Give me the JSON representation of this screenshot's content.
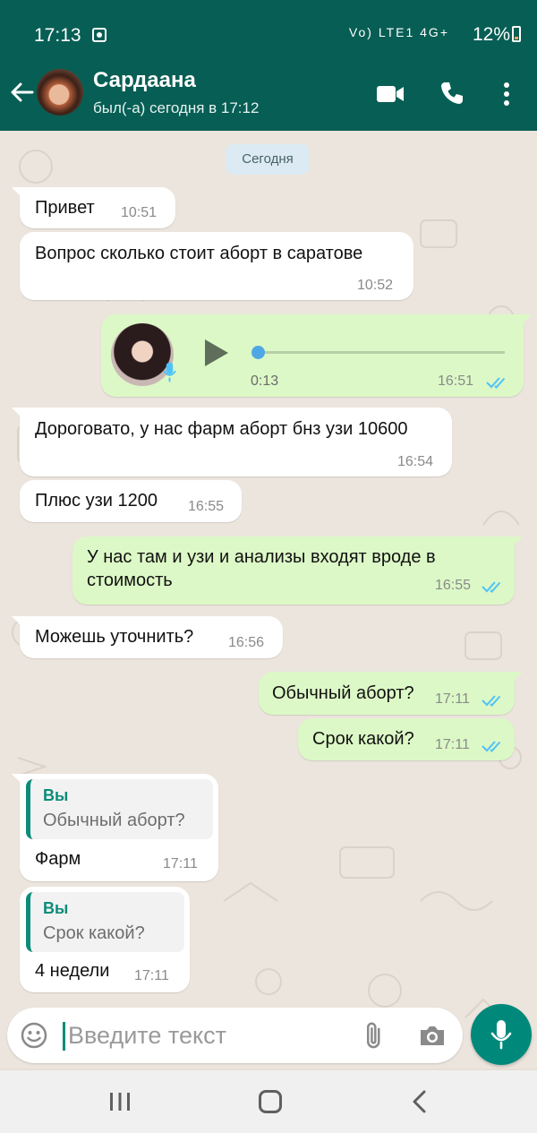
{
  "status_bar": {
    "time": "17:13",
    "network": "Vo) LTE1 4G+",
    "battery": "12%"
  },
  "header": {
    "contact_name": "Сардаана",
    "last_seen": "был(-а) сегодня в 17:12"
  },
  "chat": {
    "date_label": "Сегодня",
    "messages": [
      {
        "direction": "in",
        "text": "Привет",
        "time": "10:51"
      },
      {
        "direction": "in",
        "text": "Вопрос сколько стоит аборт в саратове",
        "time": "10:52"
      },
      {
        "direction": "out",
        "type": "voice",
        "duration": "0:13",
        "time": "16:51",
        "progress": 0
      },
      {
        "direction": "in",
        "text": "Дороговато, у нас фарм аборт бнз узи 10600",
        "time": "16:54"
      },
      {
        "direction": "in",
        "text": "Плюс узи 1200",
        "time": "16:55"
      },
      {
        "direction": "out",
        "text_line1": "У нас там и узи и анализы входят вроде в",
        "text_line2": "стоимость",
        "time": "16:55"
      },
      {
        "direction": "in",
        "text": "Можешь уточнить?",
        "time": "16:56"
      },
      {
        "direction": "out",
        "text": "Обычный аборт?",
        "time": "17:11"
      },
      {
        "direction": "out",
        "text": "Срок какой?",
        "time": "17:11"
      },
      {
        "direction": "in",
        "reply_author": "Вы",
        "reply_text": "Обычный аборт?",
        "text": "Фарм",
        "time": "17:11"
      },
      {
        "direction": "in",
        "reply_author": "Вы",
        "reply_text": "Срок какой?",
        "text": "4 недели",
        "time": "17:11"
      }
    ]
  },
  "input": {
    "placeholder": "Введите текст",
    "value": ""
  },
  "colors": {
    "header": "#075e54",
    "outgoing": "#dcf8c6",
    "incoming": "#ffffff",
    "accent": "#00897b",
    "read_ticks": "#4fc3f7"
  },
  "icons": [
    "back-arrow-icon",
    "video-call-icon",
    "phone-icon",
    "more-vert-icon",
    "play-icon",
    "mic-icon",
    "double-tick-icon",
    "emoji-icon",
    "attach-icon",
    "camera-icon",
    "recent-apps-icon",
    "home-icon",
    "nav-back-icon"
  ]
}
